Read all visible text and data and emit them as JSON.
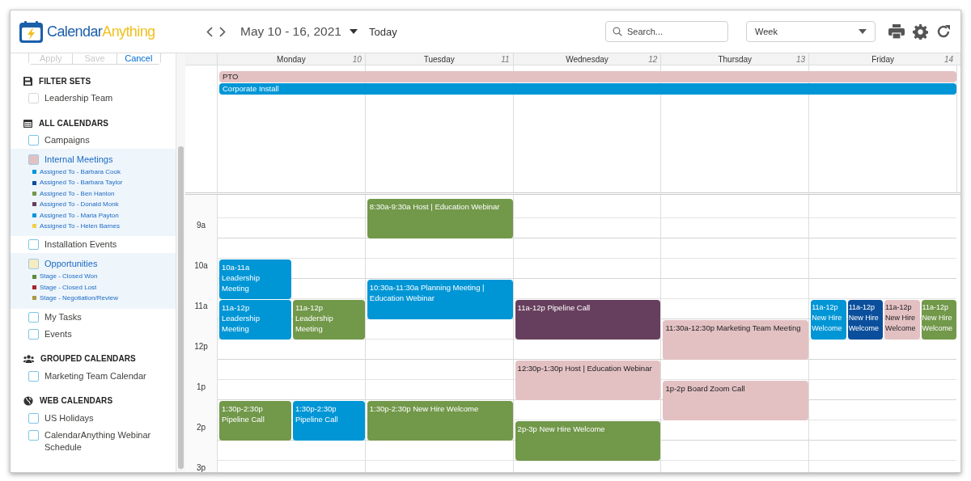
{
  "header": {
    "logo": {
      "primary": "Calendar",
      "accent": "Anything"
    },
    "date_range": "May 10 - 16, 2021",
    "today_button": "Today",
    "search": {
      "placeholder": "Search..."
    },
    "view_select": {
      "value": "Week"
    }
  },
  "sidebar": {
    "filter_buttons": [
      {
        "label": "Apply",
        "disabled": true
      },
      {
        "label": "Save",
        "disabled": true
      },
      {
        "label": "Cancel",
        "disabled": false
      }
    ],
    "sections": [
      {
        "kind": "filter-sets",
        "title": "FILTER SETS",
        "items": [
          {
            "label": "Leadership Team",
            "selected": false
          }
        ]
      },
      {
        "kind": "all",
        "title": "ALL CALENDARS",
        "items": [
          {
            "label": "Campaigns",
            "selected": false
          },
          {
            "label": "Internal Meetings",
            "selected": true,
            "color": "#e3c1c3",
            "legend": [
              {
                "label": "Assigned To - Barbara Cook",
                "color": "#0096d6"
              },
              {
                "label": "Assigned To - Barbara Taylor",
                "color": "#0b4f9c"
              },
              {
                "label": "Assigned To - Ben Hanlon",
                "color": "#72984a"
              },
              {
                "label": "Assigned To - Donald Monk",
                "color": "#673f5e"
              },
              {
                "label": "Assigned To - Maria Payton",
                "color": "#0a96d8"
              },
              {
                "label": "Assigned To - Helen Barnes",
                "color": "#f2cf4a"
              }
            ]
          },
          {
            "label": "Installation Events",
            "selected": false
          },
          {
            "label": "Opportunities",
            "selected": true,
            "color": "#f7ecc0",
            "legend": [
              {
                "label": "Stage - Closed Won",
                "color": "#5e8b3a"
              },
              {
                "label": "Stage - Closed Lost",
                "color": "#a5232f"
              },
              {
                "label": "Stage - Negotiation/Review",
                "color": "#a89a45"
              }
            ]
          },
          {
            "label": "My Tasks",
            "selected": false
          },
          {
            "label": "Events",
            "selected": false
          }
        ]
      },
      {
        "kind": "grouped",
        "title": "GROUPED CALENDARS",
        "items": [
          {
            "label": "Marketing Team Calendar",
            "selected": false
          }
        ]
      },
      {
        "kind": "web",
        "title": "WEB CALENDARS",
        "items": [
          {
            "label": "US Holidays",
            "selected": false
          },
          {
            "label": "CalendarAnything Webinar Schedule",
            "selected": false
          }
        ]
      }
    ]
  },
  "calendar": {
    "all_day_events": [
      {
        "title": "PTO",
        "color": "#e3c1c3"
      },
      {
        "title": "Corporate Install",
        "color": "#0096d6"
      }
    ],
    "time_labels": [
      "9a",
      "10a",
      "11a",
      "12p",
      "1p",
      "2p",
      "3p"
    ],
    "days": [
      {
        "name": "Monday",
        "date": "10",
        "events": [
          {
            "time": "10a-11a",
            "title": "Leadership Meeting",
            "color": "#0096d6"
          },
          {
            "time": "11a-12p",
            "title": "Leadership Meeting",
            "color": "#0096d6"
          },
          {
            "time": "11a-12p",
            "title": "Leadership Meeting",
            "color": "#72984a"
          },
          {
            "time": "1:30p-2:30p",
            "title": "Pipeline Call",
            "color": "#72984a"
          },
          {
            "time": "1:30p-2:30p",
            "title": "Pipeline Call",
            "color": "#0096d6"
          }
        ]
      },
      {
        "name": "Tuesday",
        "date": "11",
        "events": [
          {
            "time": "8:30a-9:30a",
            "title": "Host | Education Webinar",
            "color": "#72984a"
          },
          {
            "time": "10:30a-11:30a",
            "title": "Planning Meeting | Education Webinar",
            "color": "#0096d6"
          },
          {
            "time": "1:30p-2:30p",
            "title": "New Hire Welcome",
            "color": "#72984a"
          }
        ]
      },
      {
        "name": "Wednesday",
        "date": "12",
        "events": [
          {
            "time": "11a-12p",
            "title": "Pipeline Call",
            "color": "#673f5e"
          },
          {
            "time": "12:30p-1:30p",
            "title": "Host | Education Webinar",
            "color": "#e3c1c3"
          },
          {
            "time": "2p-3p",
            "title": "New Hire Welcome",
            "color": "#72984a"
          }
        ]
      },
      {
        "name": "Thursday",
        "date": "13",
        "events": [
          {
            "time": "11:30a-12:30p",
            "title": "Marketing Team Meeting",
            "color": "#e3c1c3"
          },
          {
            "time": "1p-2p",
            "title": "Board Zoom Call",
            "color": "#e3c1c3"
          }
        ]
      },
      {
        "name": "Friday",
        "date": "14",
        "events": [
          {
            "time": "11a-12p",
            "title": "New Hire Welcome",
            "color": "#0096d6"
          },
          {
            "time": "11a-12p",
            "title": "New Hire Welcome",
            "color": "#0b4f9c"
          },
          {
            "time": "11a-12p",
            "title": "New Hire Welcome",
            "color": "#e3c1c3"
          },
          {
            "time": "11a-12p",
            "title": "New Hire Welcome",
            "color": "#72984a"
          }
        ]
      }
    ]
  }
}
